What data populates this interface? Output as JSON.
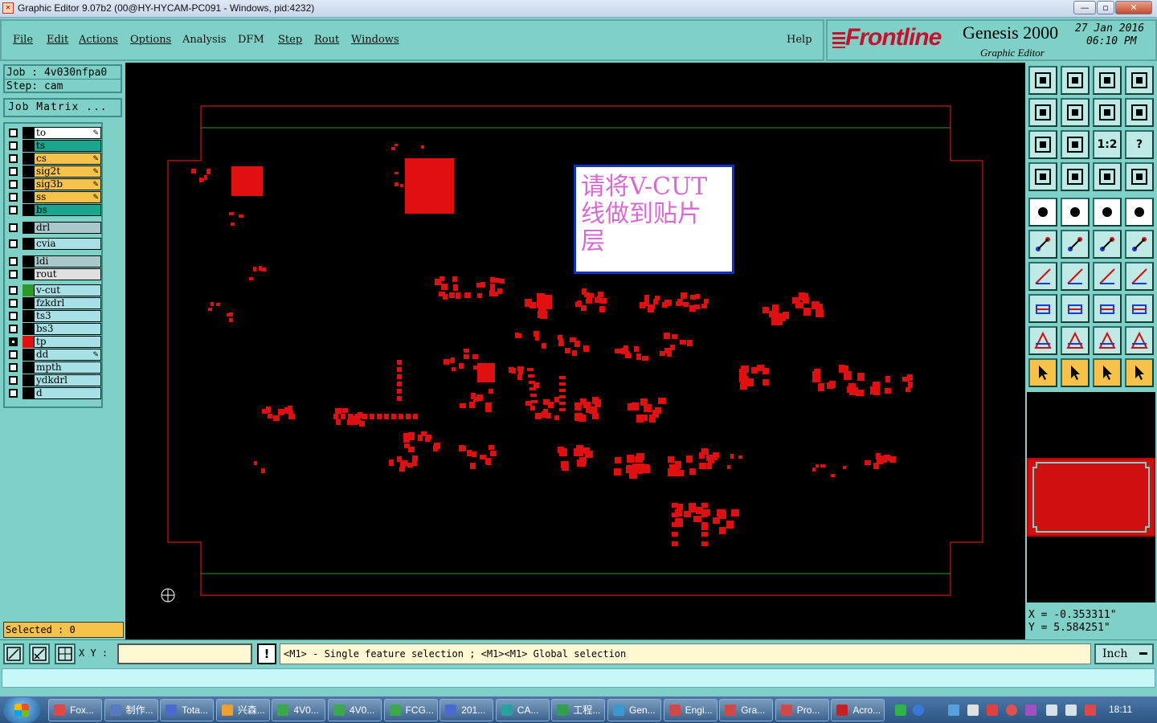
{
  "window": {
    "title": "Graphic Editor 9.07b2 (00@HY-HYCAM-PC091 - Windows, pid:4232)",
    "minimize": "—",
    "maximize": "▫",
    "close": "✕"
  },
  "menu": {
    "items": [
      "File",
      "Edit",
      "Actions",
      "Options",
      "Analysis",
      "DFM",
      "Step",
      "Rout",
      "Windows"
    ],
    "help": "Help"
  },
  "branding": {
    "logo": "Frontline",
    "product": "Genesis 2000",
    "subtitle": "Graphic Editor",
    "date": "27 Jan 2016",
    "time": "06:10 PM"
  },
  "job": {
    "job_line": "Job  : 4v030nfpa0",
    "step_line": "Step: cam",
    "matrix_button": "Job Matrix ..."
  },
  "layers": [
    {
      "name": "to",
      "color": "#ffffff",
      "edit": true,
      "checked": false
    },
    {
      "name": "ts",
      "color": "#1aa58f",
      "edit": false,
      "checked": false
    },
    {
      "name": "cs",
      "color": "#f7c24a",
      "edit": true,
      "checked": false
    },
    {
      "name": "sig2t",
      "color": "#f7c24a",
      "edit": true,
      "checked": false
    },
    {
      "name": "sig3b",
      "color": "#f7c24a",
      "edit": true,
      "checked": false
    },
    {
      "name": "ss",
      "color": "#f7c24a",
      "edit": true,
      "checked": false
    },
    {
      "name": "bs",
      "color": "#1aa58f",
      "edit": false,
      "checked": false
    },
    {
      "name": "drl",
      "color": "#a8c8cc",
      "edit": false,
      "checked": false
    },
    {
      "name": "cvia",
      "color": "#a8e0e8",
      "edit": false,
      "checked": false
    },
    {
      "name": "ldi",
      "color": "#a8c8cc",
      "edit": false,
      "checked": false
    },
    {
      "name": "rout",
      "color": "#e0e0e0",
      "edit": false,
      "checked": false
    },
    {
      "name": "v-cut",
      "color": "#a8e0e8",
      "edit": false,
      "checked": false,
      "swatch": "#2a9a2a"
    },
    {
      "name": "fzkdrl",
      "color": "#a8e0e8",
      "edit": false,
      "checked": false
    },
    {
      "name": "ts3",
      "color": "#a8e0e8",
      "edit": false,
      "checked": false
    },
    {
      "name": "bs3",
      "color": "#a8e0e8",
      "edit": false,
      "checked": false
    },
    {
      "name": "tp",
      "color": "#a8e0e8",
      "edit": false,
      "checked": true,
      "swatch": "#e01010"
    },
    {
      "name": "dd",
      "color": "#a8e0e8",
      "edit": true,
      "checked": false
    },
    {
      "name": "mpth",
      "color": "#a8e0e8",
      "edit": false,
      "checked": false
    },
    {
      "name": "ydkdrl",
      "color": "#a8e0e8",
      "edit": false,
      "checked": false
    },
    {
      "name": "d",
      "color": "#a8e0e8",
      "edit": false,
      "checked": false
    }
  ],
  "selected": "Selected : 0",
  "note": {
    "line1": "请将V-CUT",
    "line2": "线做到贴片",
    "line3": "层"
  },
  "toolbar": {
    "scale_label": "1:2",
    "help_label": "?"
  },
  "coords": {
    "x": "X = -0.353311\"",
    "y": "Y =  5.584251\""
  },
  "bottom": {
    "xy_label": "X Y :",
    "xy_value": "",
    "excl": "!",
    "message": "<M1> - Single feature selection ; <M1><M1> Global selection",
    "units": "Inch"
  },
  "taskbar": {
    "tasks": [
      "Fox...",
      "制作...",
      "Tota...",
      "兴森...",
      "4V0...",
      "4V0...",
      "FCG...",
      "201...",
      "CA...",
      "工程...",
      "Gen...",
      "Engi...",
      "Gra...",
      "Pro...",
      "Acro..."
    ],
    "clock": "18:11"
  },
  "colors": {
    "accent": "#7fd1c8",
    "feature": "#e01010",
    "outline": "#d01818",
    "vcut": "#2a9a2a"
  }
}
